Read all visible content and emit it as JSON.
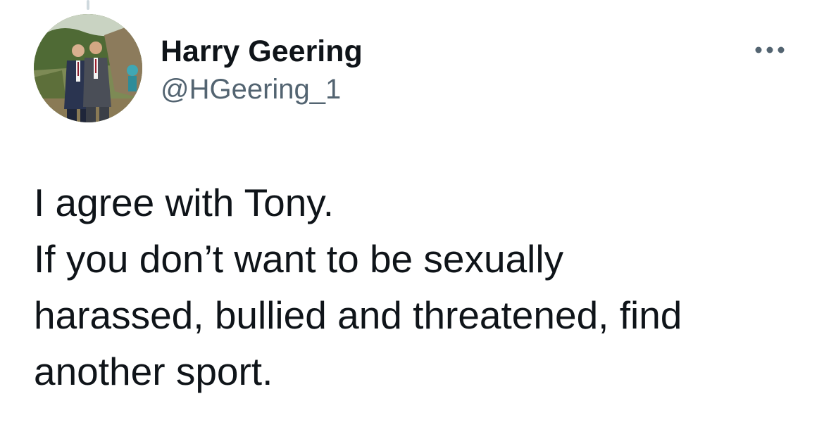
{
  "tweet": {
    "author": {
      "display_name": "Harry Geering",
      "handle": "@HGeering_1",
      "avatar_icon": "profile-photo-avatar"
    },
    "more_icon": "more-horizontal-icon",
    "text_lines": [
      "I agree with Tony.",
      "If you don’t want to be sexually",
      "harassed, bullied and threatened, find",
      "another sport."
    ]
  },
  "colors": {
    "primary_text": "#0f1419",
    "secondary_text": "#536471",
    "thread_line": "#cfd9de",
    "background": "#ffffff"
  }
}
